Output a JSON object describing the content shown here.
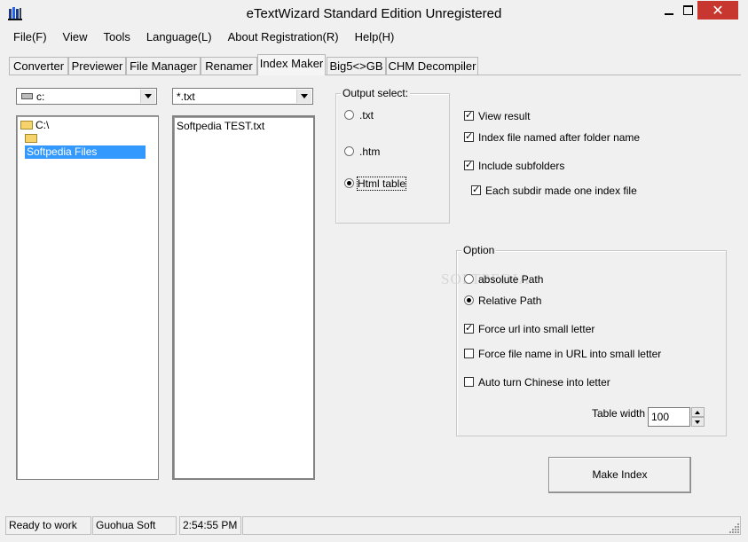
{
  "window": {
    "title": "eTextWizard Standard Edition Unregistered",
    "close_label": "✕"
  },
  "menu": [
    "File(F)",
    "View",
    "Tools",
    "Language(L)",
    "About Registration(R)",
    "Help(H)"
  ],
  "tabs": [
    {
      "label": "Converter",
      "active": false
    },
    {
      "label": "Previewer",
      "active": false
    },
    {
      "label": "File Manager",
      "active": false
    },
    {
      "label": "Renamer",
      "active": false
    },
    {
      "label": "Index Maker",
      "active": true
    },
    {
      "label": "Big5<>GB",
      "active": false
    },
    {
      "label": "CHM Decompiler",
      "active": false
    }
  ],
  "drive_select": {
    "value": "c:"
  },
  "filter_select": {
    "value": "*.txt"
  },
  "folder_tree": [
    {
      "label": "C:\\",
      "selected": false
    },
    {
      "label": "Softpedia Files",
      "selected": true
    }
  ],
  "file_list": [
    "Softpedia TEST.txt"
  ],
  "output_select": {
    "title": "Output select:",
    "options": [
      {
        "label": ".txt",
        "selected": false
      },
      {
        "label": ".htm",
        "selected": false
      },
      {
        "label": "Html table",
        "selected": true
      }
    ]
  },
  "checks": {
    "view_result": {
      "label": "View result",
      "checked": true
    },
    "index_named": {
      "label": "Index file named after folder name",
      "checked": true
    },
    "include_subfolders": {
      "label": "Include subfolders",
      "checked": true
    },
    "each_subdir": {
      "label": "Each subdir made one index file",
      "checked": true
    }
  },
  "option": {
    "title": "Option",
    "absolute_path": {
      "label": "absolute Path",
      "selected": false
    },
    "relative_path": {
      "label": "Relative Path",
      "selected": true
    },
    "force_url_lower": {
      "label": "Force url into small letter",
      "checked": true
    },
    "force_filename_lower": {
      "label": "Force file name in URL into small letter",
      "checked": false
    },
    "auto_chinese": {
      "label": "Auto turn Chinese into letter",
      "checked": false
    },
    "table_width_label": "Table width",
    "table_width": "100"
  },
  "make_index_label": "Make Index",
  "watermark": "SOFTPEDIA",
  "status": {
    "ready": "Ready to work",
    "company": "Guohua Soft",
    "time": "2:54:55 PM"
  }
}
